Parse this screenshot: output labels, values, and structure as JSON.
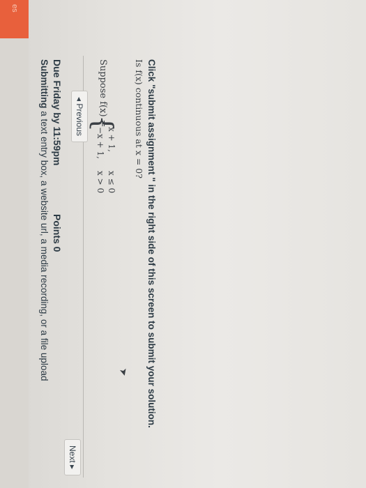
{
  "sidebar": {
    "tab_label": "es"
  },
  "details": {
    "due": "Due  Friday by 11:59pm",
    "points": "Points  0",
    "submitting_label": "Submitting",
    "submitting_text": " a text entry box, a website url, a media recording, or a file upload"
  },
  "question": {
    "suppose": "Suppose f(x) =",
    "case1_expr": "x + 1,",
    "case1_cond": "x ≤ 0",
    "case2_expr": "−x + 1,",
    "case2_cond": "x > 0",
    "ask": "Is f(x) continuous at x = 0?"
  },
  "instruction": "Click \"submit assignment \" in the right side of this screen to submit your solution.",
  "nav": {
    "previous": "◂ Previous",
    "next": "Next ▸"
  }
}
